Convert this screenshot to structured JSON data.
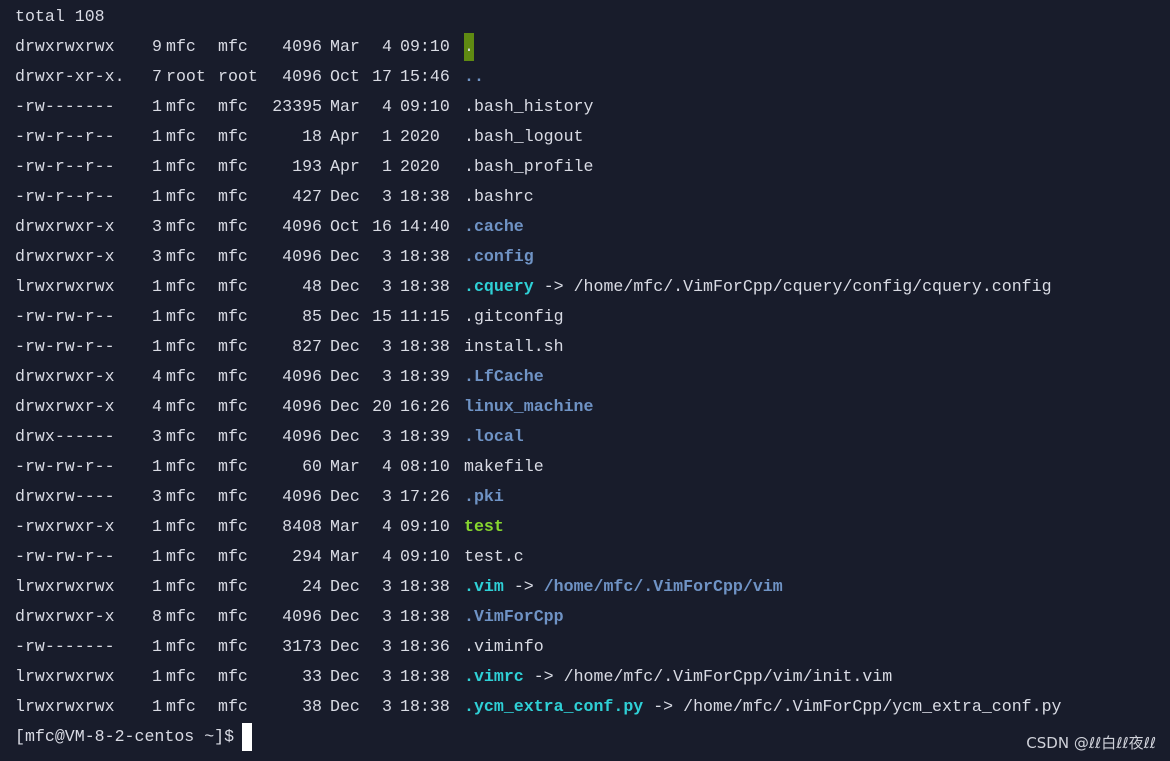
{
  "terminal": {
    "total": "total 108",
    "entries": [
      {
        "perm": "drwxrwxrwx",
        "links": "9",
        "owner": "mfc",
        "group": "mfc",
        "size": "4096",
        "mon": "Mar",
        "day": "4",
        "time": "09:10",
        "name": ".",
        "type": "cursor-dot"
      },
      {
        "perm": "drwxr-xr-x.",
        "links": "7",
        "owner": "root",
        "group": "root",
        "size": "4096",
        "mon": "Oct",
        "day": "17",
        "time": "15:46",
        "name": "..",
        "type": "dir"
      },
      {
        "perm": "-rw-------",
        "links": "1",
        "owner": "mfc",
        "group": "mfc",
        "size": "23395",
        "mon": "Mar",
        "day": "4",
        "time": "09:10",
        "name": ".bash_history",
        "type": "file"
      },
      {
        "perm": "-rw-r--r--",
        "links": "1",
        "owner": "mfc",
        "group": "mfc",
        "size": "18",
        "mon": "Apr",
        "day": "1",
        "time": "2020",
        "name": ".bash_logout",
        "type": "file"
      },
      {
        "perm": "-rw-r--r--",
        "links": "1",
        "owner": "mfc",
        "group": "mfc",
        "size": "193",
        "mon": "Apr",
        "day": "1",
        "time": "2020",
        "name": ".bash_profile",
        "type": "file"
      },
      {
        "perm": "-rw-r--r--",
        "links": "1",
        "owner": "mfc",
        "group": "mfc",
        "size": "427",
        "mon": "Dec",
        "day": "3",
        "time": "18:38",
        "name": ".bashrc",
        "type": "file"
      },
      {
        "perm": "drwxrwxr-x",
        "links": "3",
        "owner": "mfc",
        "group": "mfc",
        "size": "4096",
        "mon": "Oct",
        "day": "16",
        "time": "14:40",
        "name": ".cache",
        "type": "dir"
      },
      {
        "perm": "drwxrwxr-x",
        "links": "3",
        "owner": "mfc",
        "group": "mfc",
        "size": "4096",
        "mon": "Dec",
        "day": "3",
        "time": "18:38",
        "name": ".config",
        "type": "dir"
      },
      {
        "perm": "lrwxrwxrwx",
        "links": "1",
        "owner": "mfc",
        "group": "mfc",
        "size": "48",
        "mon": "Dec",
        "day": "3",
        "time": "18:38",
        "name": ".cquery",
        "type": "link",
        "arrow": "->",
        "target": "/home/mfc/.VimForCpp/cquery/config/cquery.config",
        "target_type": "file"
      },
      {
        "perm": "-rw-rw-r--",
        "links": "1",
        "owner": "mfc",
        "group": "mfc",
        "size": "85",
        "mon": "Dec",
        "day": "15",
        "time": "11:15",
        "name": ".gitconfig",
        "type": "file"
      },
      {
        "perm": "-rw-rw-r--",
        "links": "1",
        "owner": "mfc",
        "group": "mfc",
        "size": "827",
        "mon": "Dec",
        "day": "3",
        "time": "18:38",
        "name": "install.sh",
        "type": "file"
      },
      {
        "perm": "drwxrwxr-x",
        "links": "4",
        "owner": "mfc",
        "group": "mfc",
        "size": "4096",
        "mon": "Dec",
        "day": "3",
        "time": "18:39",
        "name": ".LfCache",
        "type": "dir"
      },
      {
        "perm": "drwxrwxr-x",
        "links": "4",
        "owner": "mfc",
        "group": "mfc",
        "size": "4096",
        "mon": "Dec",
        "day": "20",
        "time": "16:26",
        "name": "linux_machine",
        "type": "dir"
      },
      {
        "perm": "drwx------",
        "links": "3",
        "owner": "mfc",
        "group": "mfc",
        "size": "4096",
        "mon": "Dec",
        "day": "3",
        "time": "18:39",
        "name": ".local",
        "type": "dir"
      },
      {
        "perm": "-rw-rw-r--",
        "links": "1",
        "owner": "mfc",
        "group": "mfc",
        "size": "60",
        "mon": "Mar",
        "day": "4",
        "time": "08:10",
        "name": "makefile",
        "type": "file"
      },
      {
        "perm": "drwxrw----",
        "links": "3",
        "owner": "mfc",
        "group": "mfc",
        "size": "4096",
        "mon": "Dec",
        "day": "3",
        "time": "17:26",
        "name": ".pki",
        "type": "dir"
      },
      {
        "perm": "-rwxrwxr-x",
        "links": "1",
        "owner": "mfc",
        "group": "mfc",
        "size": "8408",
        "mon": "Mar",
        "day": "4",
        "time": "09:10",
        "name": "test",
        "type": "exec"
      },
      {
        "perm": "-rw-rw-r--",
        "links": "1",
        "owner": "mfc",
        "group": "mfc",
        "size": "294",
        "mon": "Mar",
        "day": "4",
        "time": "09:10",
        "name": "test.c",
        "type": "file"
      },
      {
        "perm": "lrwxrwxrwx",
        "links": "1",
        "owner": "mfc",
        "group": "mfc",
        "size": "24",
        "mon": "Dec",
        "day": "3",
        "time": "18:38",
        "name": ".vim",
        "type": "link",
        "arrow": "->",
        "target": "/home/mfc/.VimForCpp/vim",
        "target_type": "dir"
      },
      {
        "perm": "drwxrwxr-x",
        "links": "8",
        "owner": "mfc",
        "group": "mfc",
        "size": "4096",
        "mon": "Dec",
        "day": "3",
        "time": "18:38",
        "name": ".VimForCpp",
        "type": "dir"
      },
      {
        "perm": "-rw-------",
        "links": "1",
        "owner": "mfc",
        "group": "mfc",
        "size": "3173",
        "mon": "Dec",
        "day": "3",
        "time": "18:36",
        "name": ".viminfo",
        "type": "file"
      },
      {
        "perm": "lrwxrwxrwx",
        "links": "1",
        "owner": "mfc",
        "group": "mfc",
        "size": "33",
        "mon": "Dec",
        "day": "3",
        "time": "18:38",
        "name": ".vimrc",
        "type": "link",
        "arrow": "->",
        "target": "/home/mfc/.VimForCpp/vim/init.vim",
        "target_type": "file"
      },
      {
        "perm": "lrwxrwxrwx",
        "links": "1",
        "owner": "mfc",
        "group": "mfc",
        "size": "38",
        "mon": "Dec",
        "day": "3",
        "time": "18:38",
        "name": ".ycm_extra_conf.py",
        "type": "link",
        "arrow": "->",
        "target": "/home/mfc/.VimForCpp/ycm_extra_conf.py",
        "target_type": "file"
      }
    ],
    "prompt": "[mfc@VM-8-2-centos ~]$"
  },
  "colors": {
    "background": "#181c2b",
    "text": "#d9dbe4",
    "directory": "#6f93c5",
    "symlink": "#2fd0d6",
    "executable": "#87d72f",
    "dot_highlight": "#5f8a12",
    "cursor": "#ffffff"
  },
  "watermark": "CSDN @ℓℓ白ℓℓ夜ℓℓ"
}
